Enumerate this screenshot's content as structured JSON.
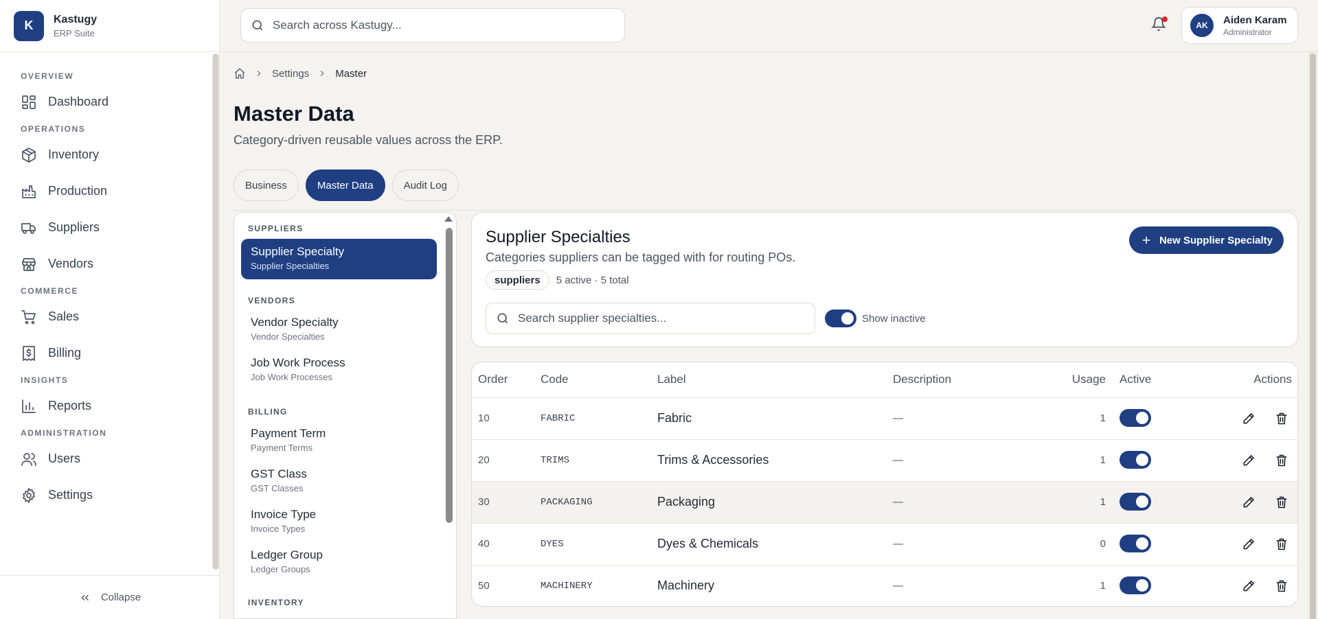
{
  "brand": {
    "initial": "K",
    "name": "Kastugy",
    "subtitle": "ERP Suite"
  },
  "sidebar": {
    "sections": [
      {
        "title": "OVERVIEW",
        "items": [
          {
            "label": "Dashboard",
            "icon": "dashboard-icon"
          }
        ]
      },
      {
        "title": "OPERATIONS",
        "items": [
          {
            "label": "Inventory",
            "icon": "box-icon"
          },
          {
            "label": "Production",
            "icon": "factory-icon"
          },
          {
            "label": "Suppliers",
            "icon": "truck-icon"
          },
          {
            "label": "Vendors",
            "icon": "store-icon"
          }
        ]
      },
      {
        "title": "COMMERCE",
        "items": [
          {
            "label": "Sales",
            "icon": "cart-icon"
          },
          {
            "label": "Billing",
            "icon": "receipt-icon"
          }
        ]
      },
      {
        "title": "INSIGHTS",
        "items": [
          {
            "label": "Reports",
            "icon": "bar-chart-icon"
          }
        ]
      },
      {
        "title": "ADMINISTRATION",
        "items": [
          {
            "label": "Users",
            "icon": "users-icon"
          },
          {
            "label": "Settings",
            "icon": "gear-icon"
          }
        ]
      }
    ],
    "collapse_label": "Collapse"
  },
  "topbar": {
    "search_placeholder": "Search across Kastugy...",
    "user": {
      "initials": "AK",
      "name": "Aiden Karam",
      "role": "Administrator"
    },
    "notification_dot_color": "#dc2626"
  },
  "breadcrumb": {
    "items": [
      "Settings",
      "Master"
    ]
  },
  "page": {
    "title": "Master Data",
    "subtitle": "Category-driven reusable values across the ERP.",
    "tabs": [
      {
        "label": "Business",
        "active": false
      },
      {
        "label": "Master Data",
        "active": true
      },
      {
        "label": "Audit Log",
        "active": false
      }
    ]
  },
  "categories": {
    "groups": [
      {
        "title": "SUPPLIERS",
        "items": [
          {
            "label": "Supplier Specialty",
            "sub": "Supplier Specialties",
            "active": true
          }
        ]
      },
      {
        "title": "VENDORS",
        "items": [
          {
            "label": "Vendor Specialty",
            "sub": "Vendor Specialties"
          },
          {
            "label": "Job Work Process",
            "sub": "Job Work Processes"
          }
        ]
      },
      {
        "title": "BILLING",
        "items": [
          {
            "label": "Payment Term",
            "sub": "Payment Terms"
          },
          {
            "label": "GST Class",
            "sub": "GST Classes"
          },
          {
            "label": "Invoice Type",
            "sub": "Invoice Types"
          },
          {
            "label": "Ledger Group",
            "sub": "Ledger Groups"
          }
        ]
      },
      {
        "title": "INVENTORY",
        "items": []
      }
    ]
  },
  "detail": {
    "title": "Supplier Specialties",
    "subtitle": "Categories suppliers can be tagged with for routing POs.",
    "chip": "suppliers",
    "counts": "5 active · 5 total",
    "new_button": "New Supplier Specialty",
    "search_placeholder": "Search supplier specialties...",
    "show_inactive_label": "Show inactive",
    "show_inactive": true
  },
  "table": {
    "columns": {
      "order": "Order",
      "code": "Code",
      "label": "Label",
      "description": "Description",
      "usage": "Usage",
      "active": "Active",
      "actions": "Actions"
    },
    "rows": [
      {
        "order": "10",
        "code": "FABRIC",
        "label": "Fabric",
        "description": "—",
        "usage": "1",
        "active": true
      },
      {
        "order": "20",
        "code": "TRIMS",
        "label": "Trims & Accessories",
        "description": "—",
        "usage": "1",
        "active": true
      },
      {
        "order": "30",
        "code": "PACKAGING",
        "label": "Packaging",
        "description": "—",
        "usage": "1",
        "active": true
      },
      {
        "order": "40",
        "code": "DYES",
        "label": "Dyes & Chemicals",
        "description": "—",
        "usage": "0",
        "active": true
      },
      {
        "order": "50",
        "code": "MACHINERY",
        "label": "Machinery",
        "description": "—",
        "usage": "1",
        "active": true
      }
    ]
  },
  "colors": {
    "accent": "#1f3f82",
    "background": "#f5f3ef"
  }
}
